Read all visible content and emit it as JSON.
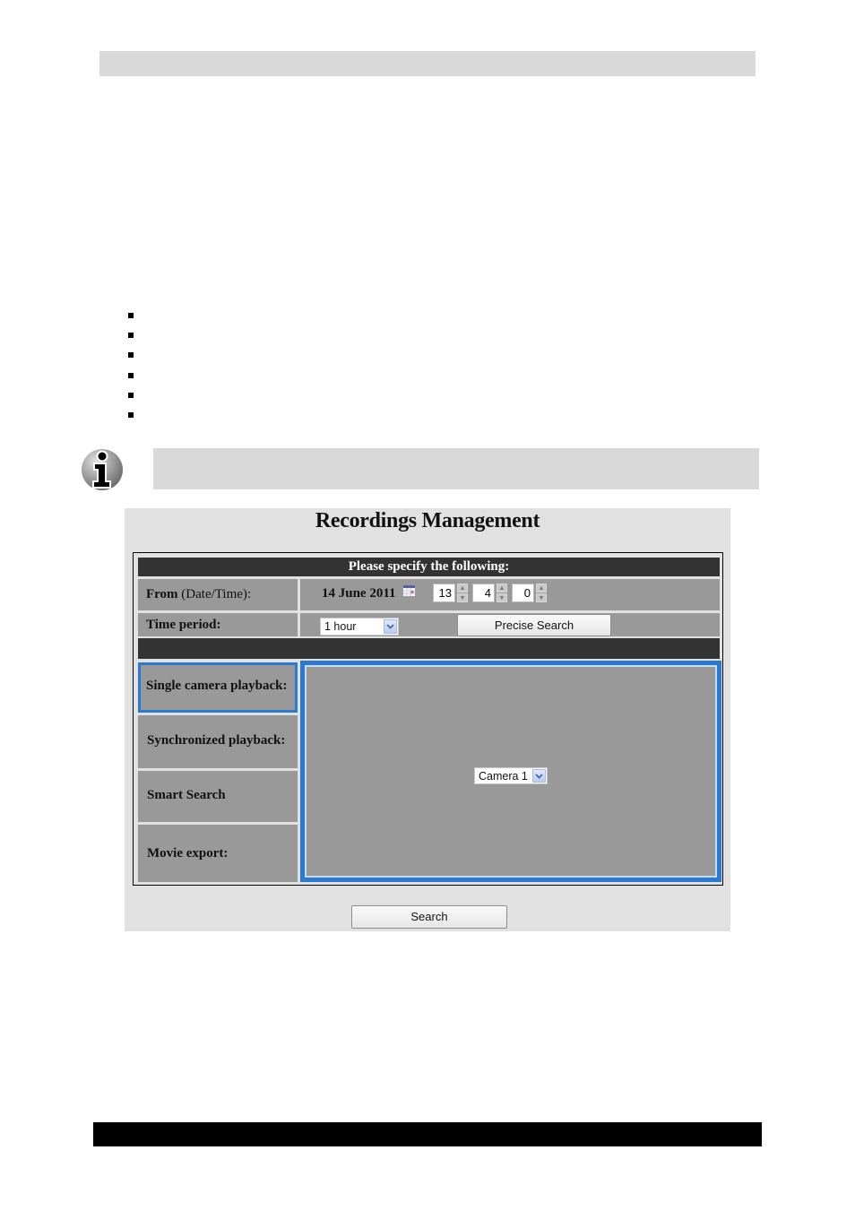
{
  "document": {
    "bullet_count": 6,
    "icons": {
      "info": "info-icon"
    }
  },
  "app": {
    "title": "Recordings Management",
    "form": {
      "header": "Please specify the following:",
      "from": {
        "label_bold": "From",
        "label_normal": "(Date/Time):",
        "date": "14 June 2011",
        "calendar_icon": "calendar-icon",
        "hour": "13",
        "minute": "4",
        "second": "0"
      },
      "time_period": {
        "label": "Time period:",
        "selected": "1 hour"
      },
      "precise_search_label": "Precise Search"
    },
    "tabs": [
      {
        "label": "Single camera playback:",
        "active": true
      },
      {
        "label": "Synchronized playback:",
        "active": false
      },
      {
        "label": "Smart Search",
        "active": false
      },
      {
        "label": "Movie export:",
        "active": false
      }
    ],
    "panel": {
      "camera_selected": "Camera 1"
    },
    "search_label": "Search",
    "colors": {
      "accent": "#2a7ad2",
      "header_dark": "#333333",
      "cell_gray": "#999999",
      "app_bg": "#e1e1e1"
    }
  }
}
